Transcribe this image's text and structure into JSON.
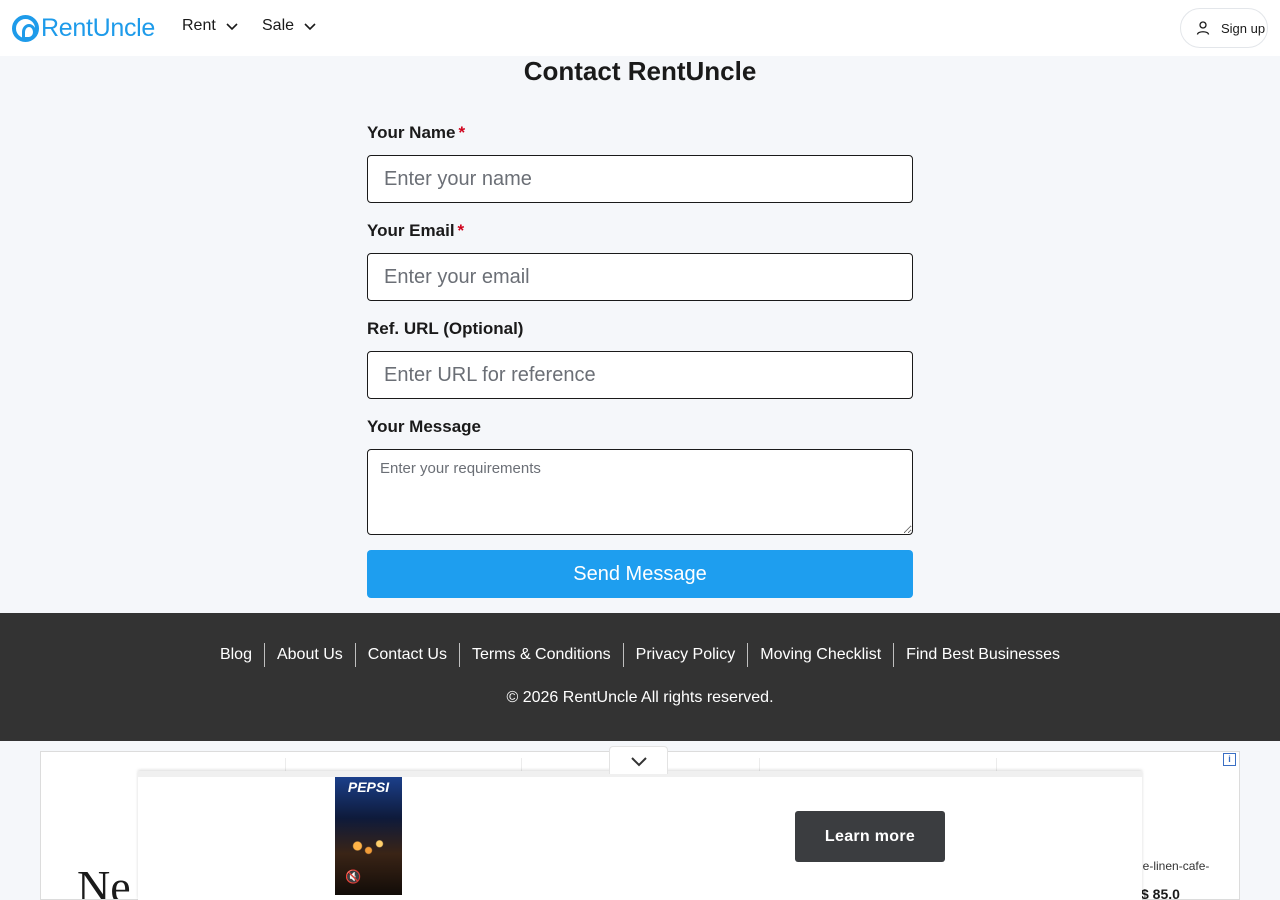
{
  "header": {
    "logo_text": "RentUncle",
    "nav": [
      {
        "label": "Rent"
      },
      {
        "label": "Sale"
      }
    ],
    "signup_label": "Sign up"
  },
  "form": {
    "title": "Contact RentUncle",
    "name": {
      "label": "Your Name",
      "required_mark": "*",
      "placeholder": "Enter your name",
      "value": ""
    },
    "email": {
      "label": "Your Email",
      "required_mark": "*",
      "placeholder": "Enter your email",
      "value": ""
    },
    "ref_url": {
      "label": "Ref. URL (Optional)",
      "placeholder": "Enter URL for reference",
      "value": ""
    },
    "message": {
      "label": "Your Message",
      "placeholder": "Enter your requirements",
      "value": ""
    },
    "submit_label": "Send Message"
  },
  "footer": {
    "links": [
      "Blog",
      "About Us",
      "Contact Us",
      "Terms & Conditions",
      "Privacy Policy",
      "Moving Checklist",
      "Find Best Businesses"
    ],
    "copyright": "© 2026 RentUncle All rights reserved."
  },
  "ads": {
    "video_brand": "PEPSI",
    "cta_label": "Learn more",
    "info_glyph": "i",
    "partial_headline": "Ne",
    "product_text": "he-linen-cafe-",
    "price": "$ 85.0"
  },
  "colors": {
    "brand": "#1e9bea",
    "button": "#1e9eef",
    "footer_bg": "#333333",
    "required": "#d0021b"
  }
}
